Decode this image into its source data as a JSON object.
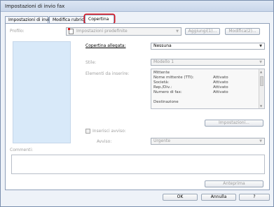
{
  "window": {
    "title": "Impostazioni di invio fax"
  },
  "tabs": [
    {
      "label": "Impostazioni di invio"
    },
    {
      "label": "Modifica rubrica"
    },
    {
      "label": "Copertina"
    }
  ],
  "profile": {
    "label": "Profilo:",
    "value": "Impostazioni predefinite",
    "add_button": "Aggiungi(1)...",
    "edit_button": "Modifica(2)..."
  },
  "cover": {
    "label": "Copertina allegata:",
    "value": "Nessuna",
    "style_label": "Stile:",
    "style_value": "Modello 1",
    "items_label": "Elementi da inserire:",
    "items": [
      {
        "name": "Mittente",
        "value": ""
      },
      {
        "name": "Nome mittente (TTI):",
        "value": "Attivato"
      },
      {
        "name": "Società:",
        "value": "Attivato"
      },
      {
        "name": "Rep./Div.:",
        "value": "Attivato"
      },
      {
        "name": "Numero di fax:",
        "value": "Attivato"
      },
      {
        "name": "",
        "value": ""
      },
      {
        "name": "Destinazione",
        "value": ""
      }
    ],
    "settings_button": "Impostazioni...",
    "urgent_label": "Inserisci avviso:",
    "notice_label": "Avviso:",
    "notice_value": "Urgente"
  },
  "comments": {
    "label": "Commenti:"
  },
  "buttons": {
    "preview": "Anteprima",
    "ok": "OK",
    "cancel": "Annulla",
    "help": "?"
  }
}
